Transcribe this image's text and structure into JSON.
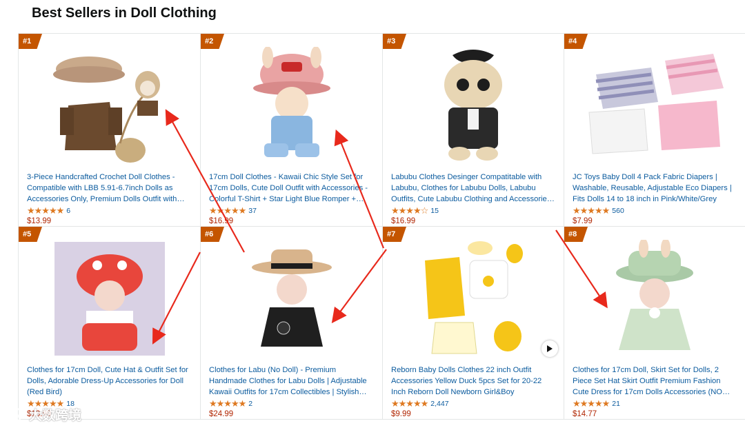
{
  "page": {
    "title": "Best Sellers in Doll Clothing"
  },
  "colors": {
    "badge": "#c45500",
    "link": "#0b5b9e",
    "price": "#b12704",
    "star": "#de7921",
    "arrow": "#e8291c"
  },
  "products": [
    {
      "rank": "#1",
      "title": "3-Piece Handcrafted Crochet Doll Clothes - Compatible with LBB 5.91-6.7inch Dolls as Accessories Only, Premium Dolls Outfit with…",
      "stars": "★★★★★",
      "rating": 5.0,
      "reviews": "6",
      "price": "$13.99"
    },
    {
      "rank": "#2",
      "title": "17cm Doll Clothes - Kawaii Chic Style Set for 17cm Dolls, Cute Doll Outfit with Accessories - Colorful T-Shirt + Star Light Blue Romper +…",
      "stars": "★★★★★",
      "rating": 4.5,
      "reviews": "37",
      "price": "$16.99"
    },
    {
      "rank": "#3",
      "title": "Labubu Clothes Desinger Compatitable with Labubu, Clothes for Labubu Dolls, Labubu Outfits, Cute Labubu Clothing and Accessorie…",
      "stars": "★★★★☆",
      "rating": 4.0,
      "reviews": "15",
      "price": "$16.99"
    },
    {
      "rank": "#4",
      "title": "JC Toys Baby Doll 4 Pack Fabric Diapers | Washable, Reusable, Adjustable Eco Diapers | Fits Dolls 14 to 18 inch in Pink/White/Grey",
      "stars": "★★★★★",
      "rating": 4.5,
      "reviews": "560",
      "price": "$7.99"
    },
    {
      "rank": "#5",
      "title": "Clothes for 17cm Doll, Cute Hat & Outfit Set for Dolls, Adorable Dress-Up Accessories for Doll (Red Bird)",
      "stars": "★★★★★",
      "rating": 4.5,
      "reviews": "18",
      "price": "$13.99"
    },
    {
      "rank": "#6",
      "title": "Clothes for Labu (No Doll) - Premium Handmade Clothes for Labu Dolls | Adjustable Kawaii Outfits for 17cm Collectibles | Stylish…",
      "stars": "★★★★★",
      "rating": 5.0,
      "reviews": "2",
      "price": "$24.99"
    },
    {
      "rank": "#7",
      "title": "Reborn Baby Dolls Clothes 22 inch Outfit Accessories Yellow Duck 5pcs Set for 20-22 Inch Reborn Doll Newborn Girl&Boy",
      "stars": "★★★★★",
      "rating": 4.8,
      "reviews": "2,447",
      "price": "$9.99",
      "video": true
    },
    {
      "rank": "#8",
      "title": "Clothes for 17cm Doll, Skirt Set for Dolls, 2 Piece Set Hat Skirt Outfit Premium Fashion Cute Dress for 17cm Dolls Accessories (NO…",
      "stars": "★★★★★",
      "rating": 4.8,
      "reviews": "21",
      "price": "$14.77"
    }
  ],
  "icons": {
    "play": "play-icon"
  },
  "watermark": {
    "text": "大数跨境"
  }
}
